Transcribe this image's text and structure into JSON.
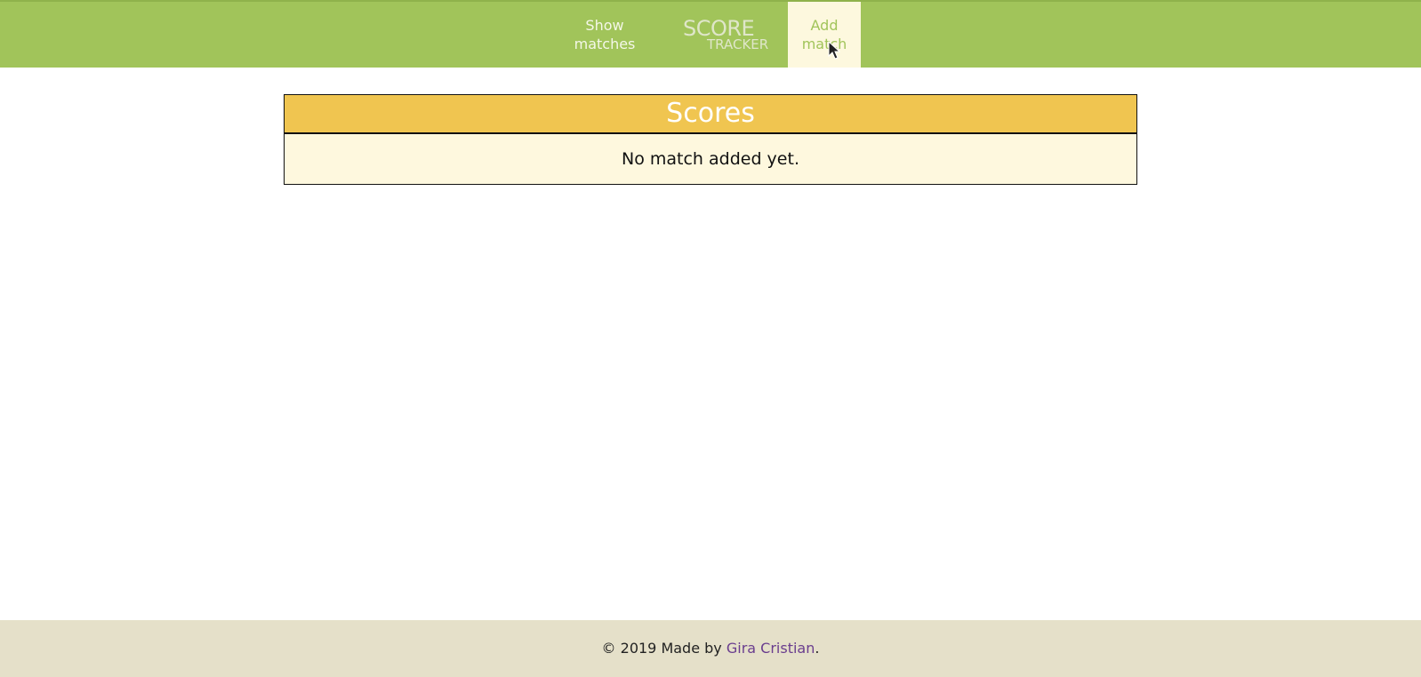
{
  "nav": {
    "show_matches": {
      "line1": "Show",
      "line2": "matches"
    },
    "brand": {
      "score": "SCORE",
      "tracker": "TRACKER"
    },
    "add_match": {
      "line1": "Add",
      "line2": "match"
    }
  },
  "scores_panel": {
    "title": "Scores",
    "empty_message": "No match added yet."
  },
  "footer": {
    "prefix": "© 2019 Made by",
    "author": "Gira Cristian",
    "suffix": "."
  },
  "colors": {
    "topbar": "#a1c45a",
    "active_tab": "#fdf8de",
    "panel_header": "#f0c550",
    "panel_body": "#fef8de",
    "footer": "#e5e0c9",
    "link": "#6a3d8e"
  }
}
